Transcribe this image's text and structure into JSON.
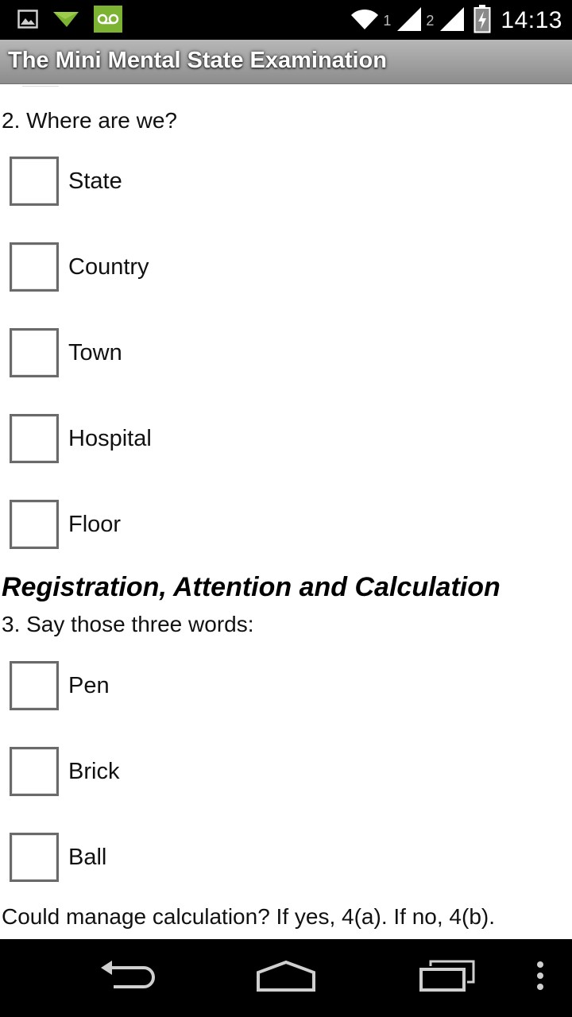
{
  "status_bar": {
    "sim1": "1",
    "sim2": "2",
    "clock": "14:13",
    "icons": [
      "image-icon",
      "send-icon",
      "voicemail-icon",
      "wifi-icon",
      "signal-icon",
      "battery-icon"
    ]
  },
  "app": {
    "title": "The Mini Mental State Examination"
  },
  "form": {
    "q2": {
      "text": "2. Where are we?",
      "options": [
        "State",
        "Country",
        "Town",
        "Hospital",
        "Floor"
      ]
    },
    "section": "Registration, Attention and Calculation",
    "q3": {
      "text": "3. Say those three words:",
      "options": [
        "Pen",
        "Brick",
        "Ball"
      ]
    },
    "note": "Could manage calculation? If yes, 4(a). If no, 4(b)."
  },
  "colors": {
    "voicemail_green": "#7cb332",
    "status_bg": "#000000",
    "title_gradient_top": "#b7b7b7",
    "title_gradient_bottom": "#8c8c8c"
  }
}
